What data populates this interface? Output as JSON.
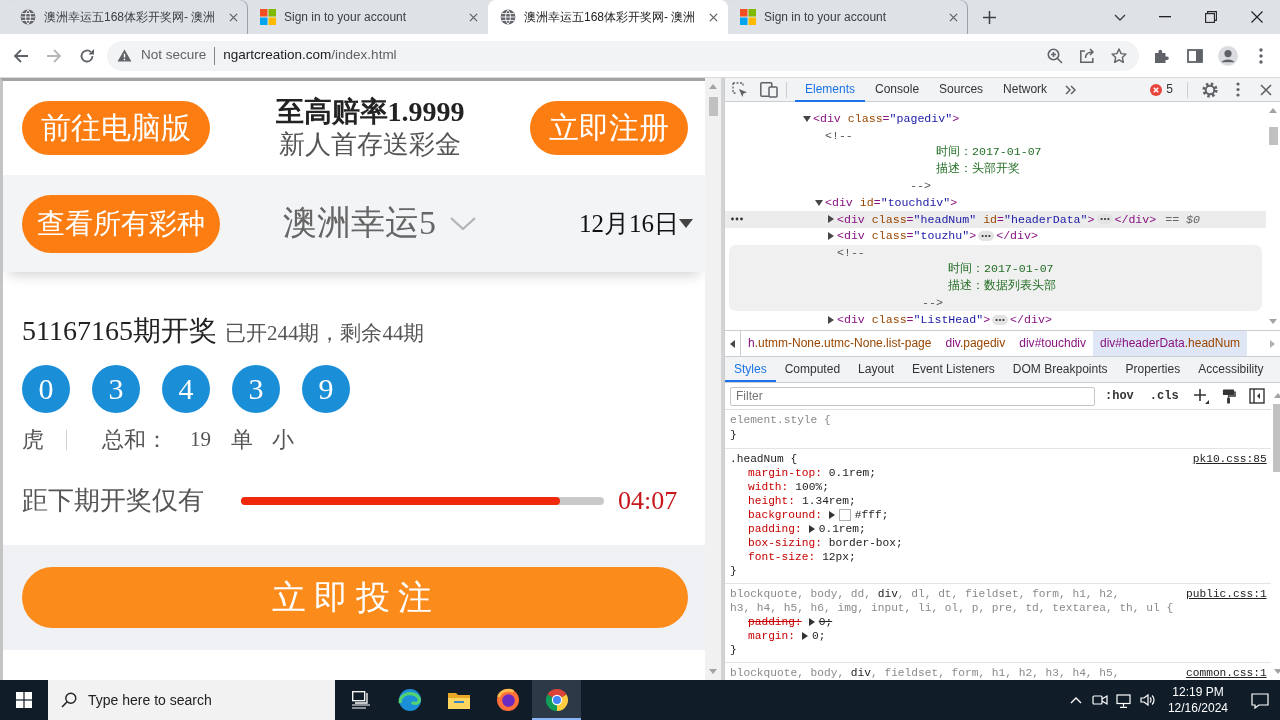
{
  "browser": {
    "tabs": [
      {
        "title": "澳洲幸运五168体彩开奖网- 澳洲",
        "kind": "site",
        "selected": false
      },
      {
        "title": "Sign in to your account",
        "kind": "microsoft",
        "selected": false
      },
      {
        "title": "澳洲幸运五168体彩开奖网- 澳洲",
        "kind": "site",
        "selected": true
      },
      {
        "title": "Sign in to your account",
        "kind": "microsoft",
        "selected": false
      }
    ],
    "address_bar": {
      "security": "Not secure",
      "domain": "ngartcreation.com",
      "path": "/index.html"
    }
  },
  "page": {
    "header": {
      "pc_button": "前往电脑版",
      "headline": "至高赔率1.9999",
      "subline": "新人首存送彩金",
      "register_button": "立即注册"
    },
    "selector": {
      "all_button": "查看所有彩种",
      "game": "澳洲幸运5",
      "date": "12月16日"
    },
    "draw": {
      "title": "51167165期开奖",
      "issue_info": "已开244期，剩余44期",
      "numbers": [
        "0",
        "3",
        "4",
        "3",
        "9"
      ],
      "dragon_tiger": "虎",
      "sum_label": "总和：",
      "sum": "19",
      "odd_even": "单",
      "big_small": "小"
    },
    "countdown": {
      "label": "距下期开奖仅有",
      "level": 0.88,
      "time": "04:07"
    },
    "bet_button": "立即投注"
  },
  "devtools": {
    "tabs": [
      {
        "label": "Elements",
        "selected": true
      },
      {
        "label": "Console",
        "selected": false
      },
      {
        "label": "Sources",
        "selected": false
      },
      {
        "label": "Network",
        "selected": false
      }
    ],
    "error_count": "5",
    "dom_tree": [
      {
        "kind": "element",
        "open": "<div class=\"pagediv\">",
        "expanded": true,
        "selected": false,
        "hovered": false,
        "children": [
          {
            "kind": "comment",
            "lines": [
              "<!--",
              "时间：2017-01-07",
              "描述：头部开奖",
              "-->"
            ],
            "selected": false,
            "hovered": false
          },
          {
            "kind": "element",
            "open": "<div id=\"touchdiv\">",
            "expanded": true,
            "selected": false,
            "hovered": false,
            "children": [
              {
                "kind": "element",
                "open": "<div class=\"headNum\" id=\"headerData\">",
                "close": "</div>",
                "suffix": "== $0",
                "expanded": false,
                "selected": true,
                "hovered": false
              },
              {
                "kind": "element",
                "open": "<div class=\"touzhu\">",
                "close": "</div>",
                "expanded": false,
                "selected": false,
                "hovered": false
              },
              {
                "kind": "comment",
                "lines": [
                  "<!--",
                  "时间：2017-01-07",
                  "描述：数据列表头部",
                  "-->"
                ],
                "selected": false,
                "hovered": true
              },
              {
                "kind": "element",
                "open": "<div class=\"ListHead\">",
                "close": "</div>",
                "expanded": false,
                "selected": false,
                "hovered": false
              }
            ]
          }
        ]
      }
    ],
    "breadcrumbs": [
      {
        "text": "h.utmm-None.utmc-None.list-page",
        "selected": false
      },
      {
        "text": "div.pagediv",
        "selected": false
      },
      {
        "text": "div#touchdiv",
        "selected": false
      },
      {
        "text": "div#headerData.headNum",
        "selected": true
      }
    ],
    "style_tabs": [
      {
        "label": "Styles",
        "selected": true
      },
      {
        "label": "Computed",
        "selected": false
      },
      {
        "label": "Layout",
        "selected": false
      },
      {
        "label": "Event Listeners",
        "selected": false
      },
      {
        "label": "DOM Breakpoints",
        "selected": false
      },
      {
        "label": "Properties",
        "selected": false
      },
      {
        "label": "Accessibility",
        "selected": false
      }
    ],
    "filter": {
      "placeholder": "Filter"
    },
    "toggles": [
      ":hov",
      ".cls"
    ],
    "rules": [
      {
        "selector": [
          {
            "text": "element.style {",
            "matched": false
          }
        ],
        "close": "}"
      },
      {
        "selector": [
          {
            "text": ".headNum {",
            "matched": true
          }
        ],
        "source": "pk10.css:85",
        "declarations": [
          {
            "name": "margin-top:",
            "value": "0.1rem;",
            "expandable": false,
            "overridden": false
          },
          {
            "name": "width:",
            "value": "100%;",
            "expandable": false,
            "overridden": false
          },
          {
            "name": "height:",
            "value": "1.34rem;",
            "expandable": false,
            "overridden": false
          },
          {
            "name": "background:",
            "value": "#fff;",
            "expandable": true,
            "overridden": false,
            "color": "#ffffff"
          },
          {
            "name": "padding:",
            "value": "0.1rem;",
            "expandable": true,
            "overridden": false
          },
          {
            "name": "box-sizing:",
            "value": "border-box;",
            "expandable": false,
            "overridden": false
          },
          {
            "name": "font-size:",
            "value": "12px;",
            "expandable": false,
            "overridden": false
          }
        ],
        "close": "}"
      },
      {
        "selector": [
          {
            "text": "blockquote, body, dd, ",
            "matched": false
          },
          {
            "text": "div",
            "matched": true
          },
          {
            "text": ", dl, dt, fieldset, form, h1, h2, h3, h4, h5, h6, img, input, li, ol, p, pre, td, textarea, th, ul {",
            "matched": false
          }
        ],
        "source": "public.css:1",
        "declarations": [
          {
            "name": "padding:",
            "value": "0;",
            "expandable": true,
            "overridden": true
          },
          {
            "name": "margin:",
            "value": "0;",
            "expandable": true,
            "overridden": false
          }
        ],
        "close": "}"
      },
      {
        "selector": [
          {
            "text": "blockquote, body, ",
            "matched": false
          },
          {
            "text": "div",
            "matched": true
          },
          {
            "text": ", fieldset, form, h1, h2, h3, h4, h5,",
            "matched": false
          }
        ],
        "source": "common.css:1"
      }
    ]
  },
  "taskbar": {
    "search_placeholder": "Type here to search",
    "apps": [
      {
        "kind": "task_view",
        "active": false
      },
      {
        "kind": "edge",
        "active": false
      },
      {
        "kind": "explorer",
        "active": false
      },
      {
        "kind": "firefox",
        "active": false
      },
      {
        "kind": "chrome",
        "active": true
      }
    ],
    "time": "12:19 PM",
    "date": "12/16/2024"
  }
}
